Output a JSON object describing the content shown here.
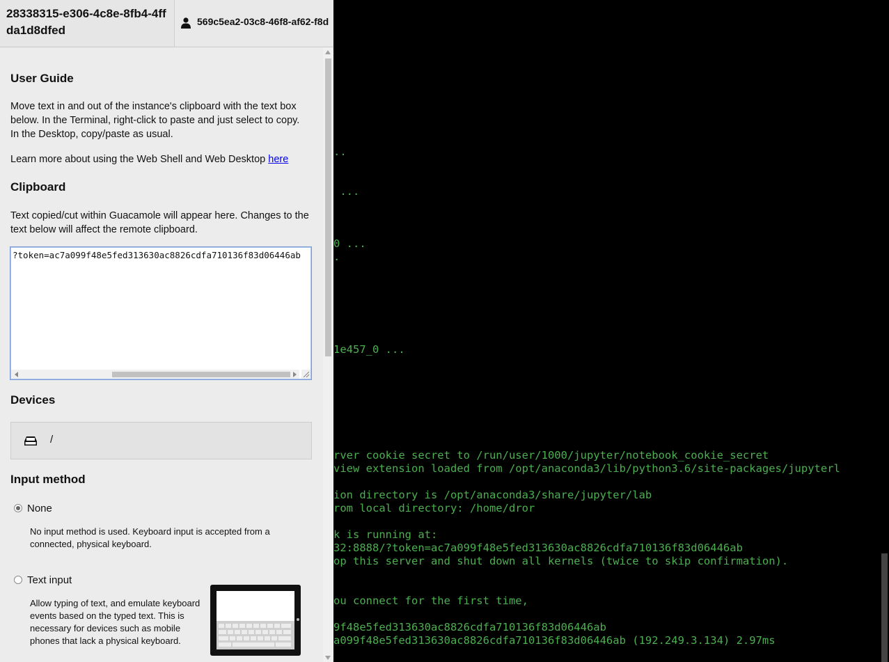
{
  "connection": {
    "title": "28338315-e306-4c8e-8fb4-4ffda1d8dfed",
    "username": "569c5ea2-03c8-46f8-af62-f8d",
    "user_icon": "user-icon"
  },
  "user_guide": {
    "heading": "User Guide",
    "text": "Move text in and out of the instance's clipboard with the text box below. In the Terminal, right-click to paste and just select to copy. In the Desktop, copy/paste as usual.",
    "learn_more_prefix": "Learn more about using the Web Shell and Web Desktop ",
    "learn_more_link": "here"
  },
  "clipboard": {
    "heading": "Clipboard",
    "description": "Text copied/cut within Guacamole will appear here. Changes to the text below will affect the remote clipboard.",
    "value": "?token=ac7a099f48e5fed313630ac8826cdfa710136f83d06446ab"
  },
  "devices": {
    "heading": "Devices",
    "items": [
      {
        "icon": "drive-icon",
        "path": "/"
      }
    ]
  },
  "input_method": {
    "heading": "Input method",
    "options": [
      {
        "label": "None",
        "selected": true,
        "description": "No input method is used. Keyboard input is accepted from a connected, physical keyboard."
      },
      {
        "label": "Text input",
        "selected": false,
        "description": "Allow typing of text, and emulate keyboard events based on the typed text. This is necessary for devices such as mobile phones that lack a physical keyboard.",
        "icon": "tablet-keyboard-icon"
      }
    ]
  },
  "terminal": {
    "text_color": "#4caf50",
    "lines": [
      "..",
      " ...",
      "0 ...",
      ".",
      "1e457_0 ...",
      "rver cookie secret to /run/user/1000/jupyter/notebook_cookie_secret",
      "view extension loaded from /opt/anaconda3/lib/python3.6/site-packages/jupyterl",
      "ion directory is /opt/anaconda3/share/jupyter/lab",
      "rom local directory: /home/dror",
      "k is running at:",
      "32:8888/?token=ac7a099f48e5fed313630ac8826cdfa710136f83d06446ab",
      "op this server and shut down all kernels (twice to skip confirmation).",
      "ou connect for the first time,",
      "9f48e5fed313630ac8826cdfa710136f83d06446ab",
      "a099f48e5fed313630ac8826cdfa710136f83d06446ab (192.249.3.134) 2.97ms"
    ]
  }
}
